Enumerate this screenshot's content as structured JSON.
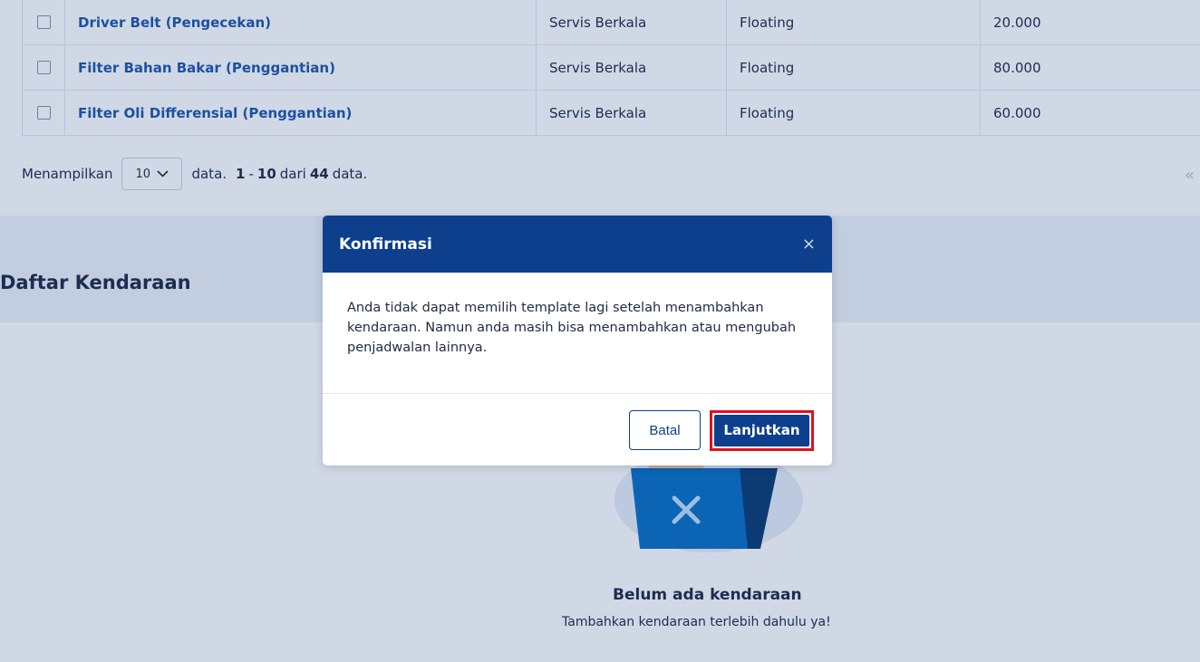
{
  "table": {
    "rows": [
      {
        "name": "Driver Belt (Pengecekan)",
        "category": "Servis Berkala",
        "type": "Floating",
        "price": "20.000"
      },
      {
        "name": "Filter Bahan Bakar (Penggantian)",
        "category": "Servis Berkala",
        "type": "Floating",
        "price": "80.000"
      },
      {
        "name": "Filter Oli Differensial (Penggantian)",
        "category": "Servis Berkala",
        "type": "Floating",
        "price": "60.000"
      }
    ]
  },
  "pagination": {
    "prefix": "Menampilkan",
    "page_size": "10",
    "middle": "data.",
    "range_start": "1",
    "range_dash": "-",
    "range_end": "10",
    "of_word": "dari",
    "total": "44",
    "suffix": "data.",
    "first_page_symbol": "«"
  },
  "section": {
    "title": "Daftar Kendaraan"
  },
  "empty_state": {
    "title": "Belum ada kendaraan",
    "subtitle": "Tambahkan kendaraan terlebih dahulu ya!"
  },
  "modal": {
    "title": "Konfirmasi",
    "close_symbol": "×",
    "message": "Anda tidak dapat memilih template lagi setelah menambahkan kendaraan. Namun anda masih bisa menambahkan atau mengubah penjadwalan lainnya.",
    "cancel_label": "Batal",
    "continue_label": "Lanjutkan"
  },
  "colors": {
    "primary": "#0d3f8c",
    "link": "#1f57a7",
    "highlight": "#e0111b",
    "illustration_blue": "#0a6fc2"
  }
}
